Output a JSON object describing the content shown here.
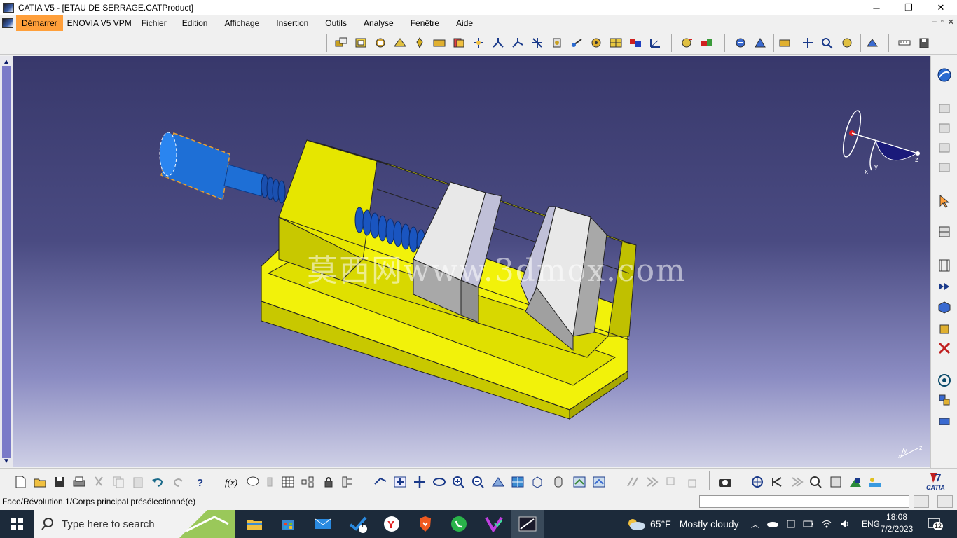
{
  "window": {
    "title": "CATIA V5 - [ETAU DE SERRAGE.CATProduct]",
    "controls": [
      "─",
      "❐",
      "✕"
    ]
  },
  "menu": {
    "items": [
      "Démarrer",
      "ENOVIA V5 VPM",
      "Fichier",
      "Edition",
      "Affichage",
      "Insertion",
      "Outils",
      "Analyse",
      "Fenêtre",
      "Aide"
    ],
    "doc_controls": [
      "–",
      "▫",
      "✕"
    ]
  },
  "viewport": {
    "watermark": "莫西网www.3dmox.com",
    "compass_labels": {
      "x": "x",
      "y": "y",
      "z": "z"
    },
    "axis_labels": {
      "x": "x",
      "y": "y",
      "z": "z"
    }
  },
  "status": {
    "text": "Face/Révolution.1/Corps principal présélectionné(e)",
    "power_input": ""
  },
  "taskbar": {
    "search_placeholder": "Type here to search",
    "weather_temp": "65°F",
    "weather_text": "Mostly cloudy",
    "language": "ENG",
    "time": "18:08",
    "date": "7/2/2023",
    "notification_count": "12",
    "badge_count": "1"
  },
  "colors": {
    "viewport_top": "#38386b",
    "viewport_bottom": "#cfd0e6",
    "part_yellow": "#f2f20a",
    "screw_blue": "#1e6fd6",
    "jaw_grey": "#a8a8a8",
    "menu_active": "#ff9f3a",
    "taskbar": "#1c2a3a"
  }
}
